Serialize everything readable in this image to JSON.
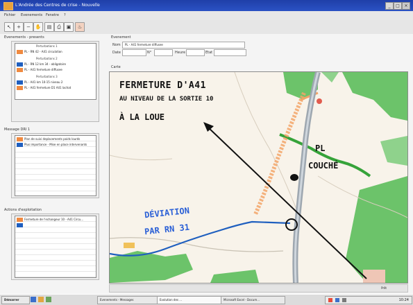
{
  "window": {
    "title": "L'Andrée des Centres de crise - Nouvelle",
    "min": "_",
    "max": "□",
    "close": "×"
  },
  "menu": [
    "Fichier",
    "Evenements",
    "Fenetre",
    "?"
  ],
  "toolbar_icons": [
    "pointer-icon",
    "zoom-in-icon",
    "zoom-out-icon",
    "hand-icon",
    "layers-icon",
    "print-icon",
    "save-icon",
    "fire-icon"
  ],
  "left": {
    "section1_title": "Evenements - presents",
    "events": [
      {
        "header": "Perturbations 1",
        "line": "PL - RN 42 - A41 circulation",
        "color": "#f08a40"
      },
      {
        "header": "Perturbations 2",
        "line": "PL - RN 12 km 34 - obligatoire",
        "color": "#1f5fbf"
      },
      {
        "header": "",
        "line": "PL - A41 fermeture diffusee",
        "color": "#f08a40"
      },
      {
        "header": "Perturbations 3",
        "line": "PL - A41 km 10-15 niveau 2",
        "color": "#1f5fbf"
      },
      {
        "header": "",
        "line": "PL - A41 fermeture D1 A41 lachat",
        "color": "#f08a40"
      }
    ],
    "section2_title": "Message DRI 1",
    "messages": [
      {
        "text": "Plan de suivi deplacements poids lourds",
        "color": "#f08a40"
      },
      {
        "text": "Plus importance - Mise en place intervenants",
        "color": "#1f5fbf"
      }
    ],
    "section3_title": "Actions d'exploitation",
    "actions": [
      {
        "text": "Fermeture de l'echangeur 10 - A41 Circu...",
        "color": "#f08a40"
      },
      {
        "text": "",
        "color": "#1f5fbf"
      }
    ]
  },
  "right": {
    "section_title": "Evenement",
    "form": {
      "nom_label": "Nom",
      "nom_value": "PL - A41 fermeture diffusee",
      "date_label": "Date",
      "heure_label": "Heure",
      "num_label": "N°",
      "etat_label": "Etat"
    },
    "map_title": "Carte",
    "annotations": {
      "black1": "FERMETURE D'A41",
      "black2": "AU NIVEAU DE LA SORTIE 10",
      "black3": "À LA LOUE",
      "pl1": "PL",
      "pl2": "COUCHÉ",
      "blue1": "DÉVIATION",
      "blue2": "PAR RN 31"
    },
    "status": "Prêt"
  },
  "taskbar": {
    "start": "Démarrer",
    "tasks": [
      "Evenements - Messages",
      "Evolution des ...",
      "Microsoft Excel - Docum..."
    ],
    "clock": "10:24"
  },
  "colors": {
    "orange": "#f08a40",
    "blue": "#1f5fbf",
    "map_green": "#6cc36a",
    "road": "#9ea7b0"
  }
}
